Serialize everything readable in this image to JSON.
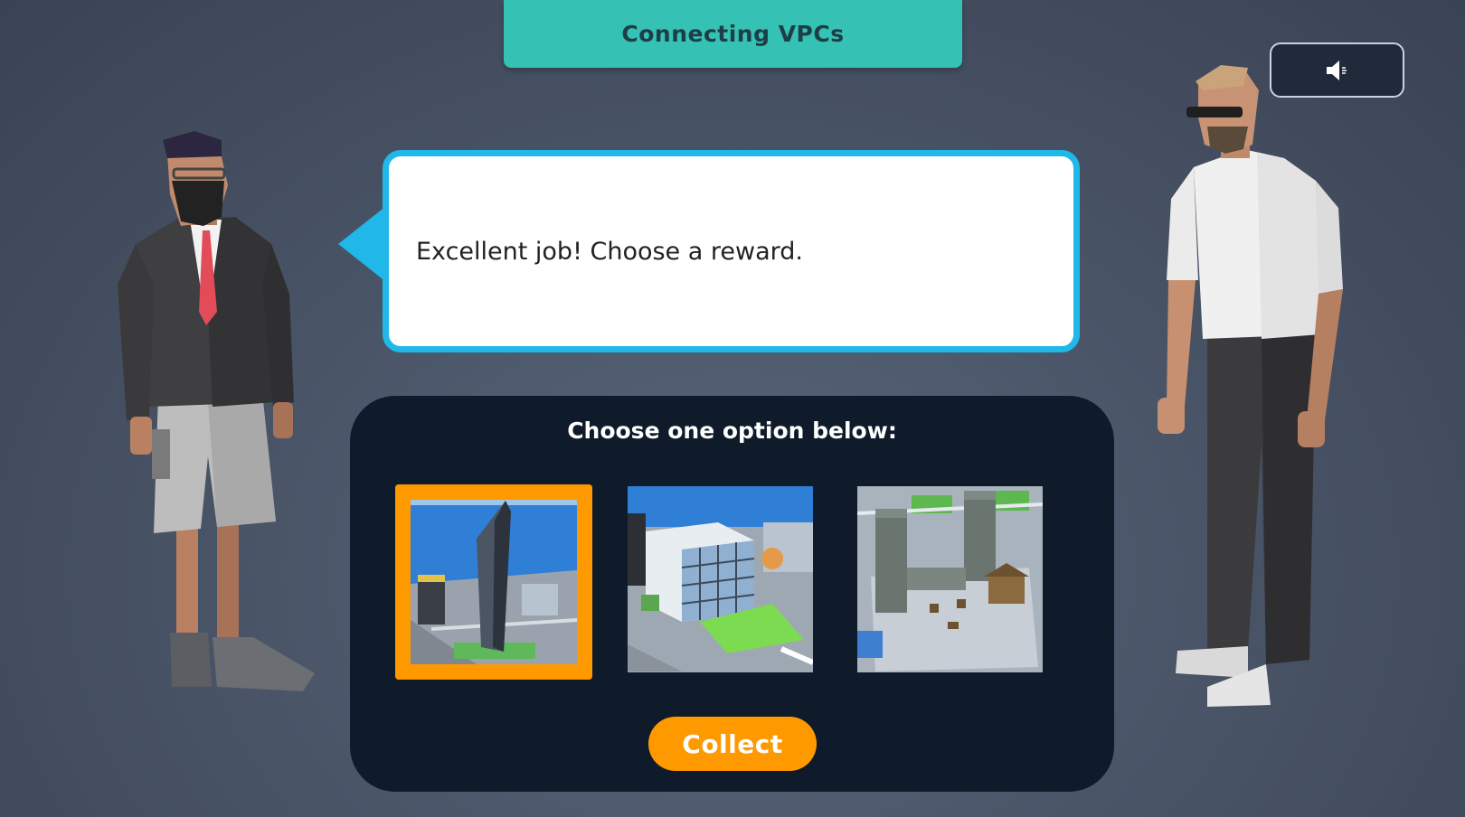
{
  "header": {
    "title": "Connecting VPCs"
  },
  "sound": {
    "icon": "speaker-icon"
  },
  "dialog": {
    "message": "Excellent job! Choose a reward."
  },
  "rewards": {
    "heading": "Choose one option below:",
    "options": [
      {
        "name": "skyscraper-tower",
        "selected": true
      },
      {
        "name": "office-building-park",
        "selected": false
      },
      {
        "name": "castle-towers",
        "selected": false
      }
    ],
    "collect_label": "Collect"
  },
  "colors": {
    "title_banner": "#35c1b3",
    "bubble_border": "#1fb8e8",
    "panel": "#0f1b2b",
    "accent": "#ff9900"
  }
}
